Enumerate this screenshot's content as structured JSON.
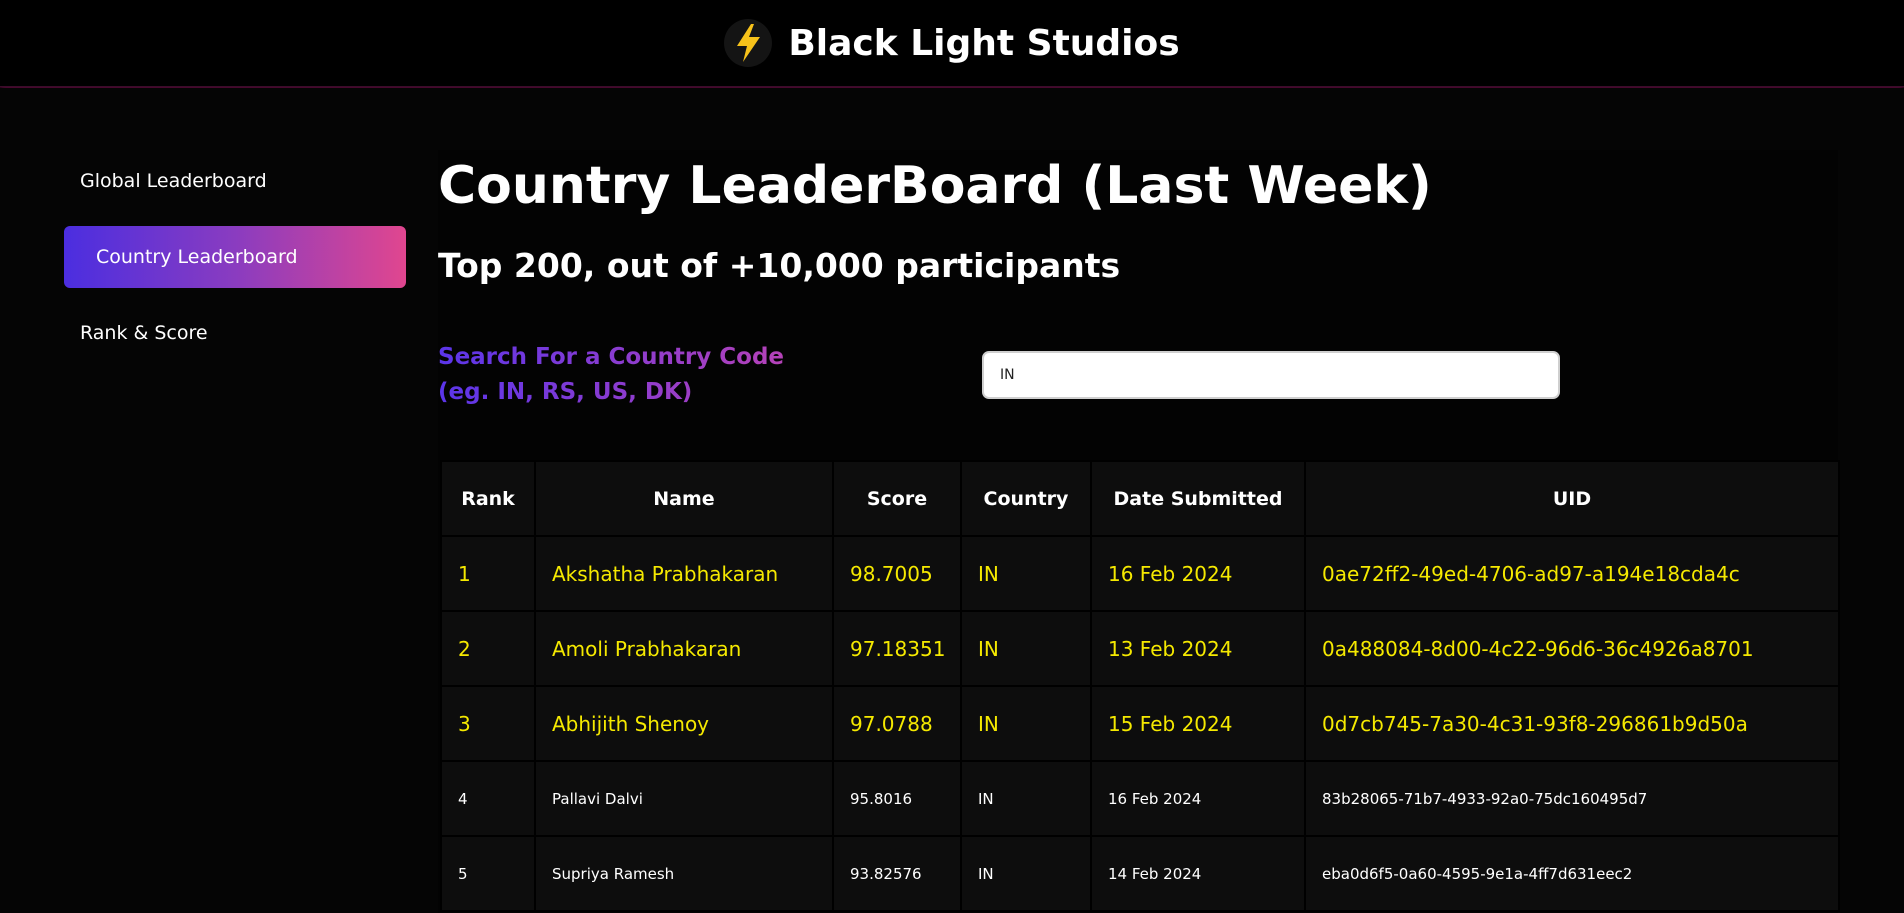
{
  "header": {
    "title": "Black Light Studios",
    "logo_icon": "lightning-bolt-icon"
  },
  "sidebar": {
    "items": [
      {
        "label": "Global Leaderboard",
        "active": false
      },
      {
        "label": "Country Leaderboard",
        "active": true
      },
      {
        "label": "Rank & Score",
        "active": false
      }
    ]
  },
  "main": {
    "title": "Country LeaderBoard (Last Week)",
    "subtitle": "Top 200, out of +10,000 participants",
    "search": {
      "label_line1": "Search For a Country Code",
      "label_line2": "(eg. IN, RS, US, DK)",
      "value": "IN"
    },
    "table": {
      "columns": [
        "Rank",
        "Name",
        "Score",
        "Country",
        "Date Submitted",
        "UID"
      ],
      "rows": [
        [
          "1",
          "Akshatha Prabhakaran",
          "98.7005",
          "IN",
          "16 Feb 2024",
          "0ae72ff2-49ed-4706-ad97-a194e18cda4c"
        ],
        [
          "2",
          "Amoli Prabhakaran",
          "97.18351",
          "IN",
          "13 Feb 2024",
          "0a488084-8d00-4c22-96d6-36c4926a8701"
        ],
        [
          "3",
          "Abhijith Shenoy",
          "97.0788",
          "IN",
          "15 Feb 2024",
          "0d7cb745-7a30-4c31-93f8-296861b9d50a"
        ],
        [
          "4",
          "Pallavi Dalvi",
          "95.8016",
          "IN",
          "16 Feb 2024",
          "83b28065-71b7-4933-92a0-75dc160495d7"
        ],
        [
          "5",
          "Supriya Ramesh",
          "93.82576",
          "IN",
          "14 Feb 2024",
          "eba0d6f5-0a60-4595-9e1a-4ff7d631eec2"
        ]
      ]
    }
  },
  "colors": {
    "background": "#000000",
    "accent_gradient_start": "#4b2ee0",
    "accent_gradient_end": "#e0468f",
    "highlight": "#f5e900"
  }
}
